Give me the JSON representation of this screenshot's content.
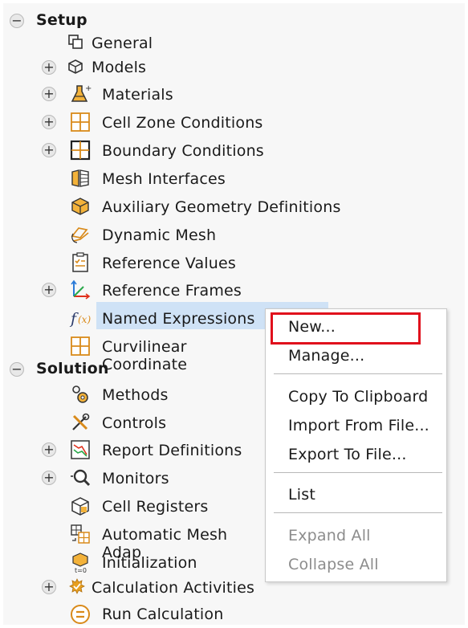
{
  "tree": {
    "setup": {
      "label": "Setup"
    },
    "items_setup": [
      {
        "label": "General",
        "icon": "general-icon"
      },
      {
        "label": "Models",
        "icon": "models-icon"
      },
      {
        "label": "Materials",
        "icon": "materials-icon"
      },
      {
        "label": "Cell Zone Conditions",
        "icon": "cell-zone-icon"
      },
      {
        "label": "Boundary Conditions",
        "icon": "boundary-icon"
      },
      {
        "label": "Mesh Interfaces",
        "icon": "mesh-interfaces-icon"
      },
      {
        "label": "Auxiliary Geometry Definitions",
        "icon": "aux-geometry-icon"
      },
      {
        "label": "Dynamic Mesh",
        "icon": "dynamic-mesh-icon"
      },
      {
        "label": "Reference Values",
        "icon": "reference-values-icon"
      },
      {
        "label": "Reference Frames",
        "icon": "reference-frames-icon"
      },
      {
        "label": "Named Expressions",
        "icon": "named-expressions-icon"
      },
      {
        "label": "Curvilinear Coordinate",
        "icon": "curvilinear-icon"
      }
    ],
    "solution": {
      "label": "Solution"
    },
    "items_solution": [
      {
        "label": "Methods",
        "icon": "methods-icon"
      },
      {
        "label": "Controls",
        "icon": "controls-icon"
      },
      {
        "label": "Report Definitions",
        "icon": "report-definitions-icon"
      },
      {
        "label": "Monitors",
        "icon": "monitors-icon"
      },
      {
        "label": "Cell Registers",
        "icon": "cell-registers-icon"
      },
      {
        "label": "Automatic Mesh Adap",
        "icon": "mesh-adaption-icon"
      },
      {
        "label": "Initialization",
        "icon": "initialization-icon"
      },
      {
        "label": "Calculation Activities",
        "icon": "calc-activities-icon"
      },
      {
        "label": "Run Calculation",
        "icon": "run-calculation-icon"
      }
    ]
  },
  "context_menu": {
    "items": [
      {
        "label": "New...",
        "enabled": true
      },
      {
        "label": "Manage...",
        "enabled": true
      },
      {
        "label": "Copy To Clipboard",
        "enabled": true
      },
      {
        "label": "Import From File...",
        "enabled": true
      },
      {
        "label": "Export To File...",
        "enabled": true
      },
      {
        "label": "List",
        "enabled": true
      },
      {
        "label": "Expand All",
        "enabled": false
      },
      {
        "label": "Collapse All",
        "enabled": false
      }
    ]
  },
  "colors": {
    "highlight_box": "#e0101c",
    "selection": "#cfe2f6",
    "icon_orange": "#d98a1a"
  }
}
